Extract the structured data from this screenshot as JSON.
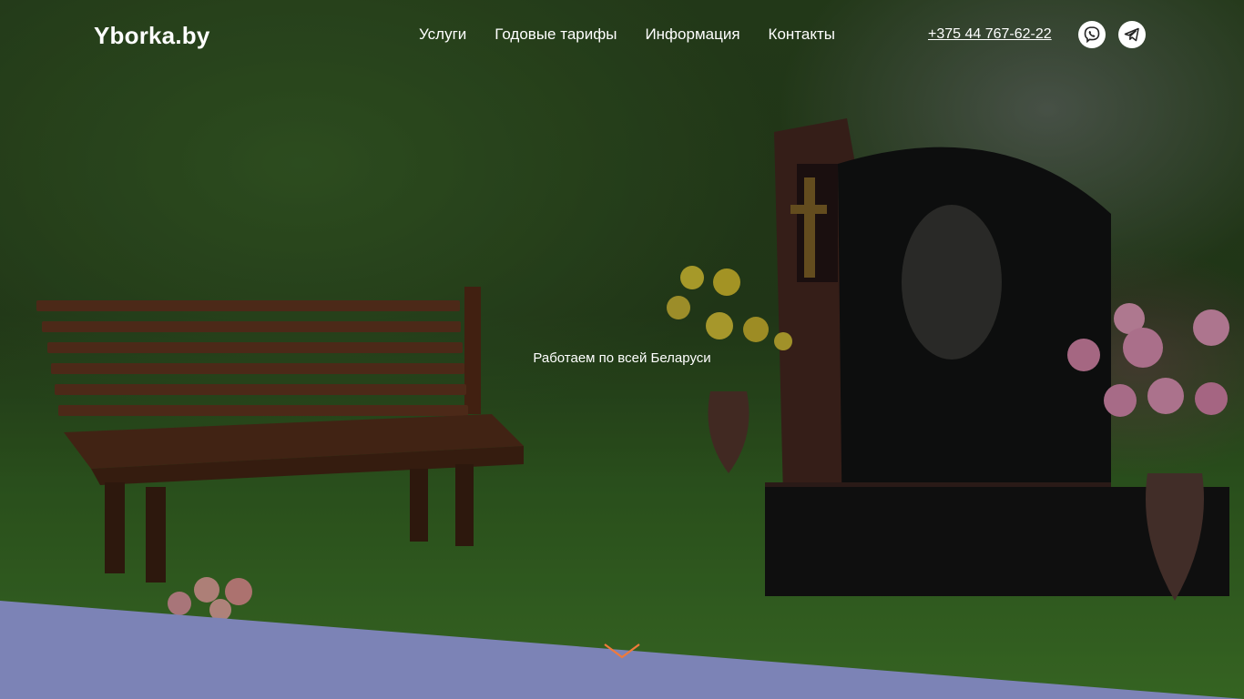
{
  "site": {
    "logo": "Yborka.by"
  },
  "nav": {
    "items": [
      {
        "label": "Услуги"
      },
      {
        "label": "Годовые тарифы"
      },
      {
        "label": "Информация"
      },
      {
        "label": "Контакты"
      }
    ]
  },
  "contacts": {
    "phone": "+375 44 767-62-22"
  },
  "social": {
    "viber_icon": "viber-icon",
    "telegram_icon": "telegram-icon"
  },
  "hero": {
    "tagline": "Работаем по всей Беларуси"
  },
  "colors": {
    "band": "#7c83b6",
    "accent": "#f07a3a",
    "text": "#ffffff"
  }
}
